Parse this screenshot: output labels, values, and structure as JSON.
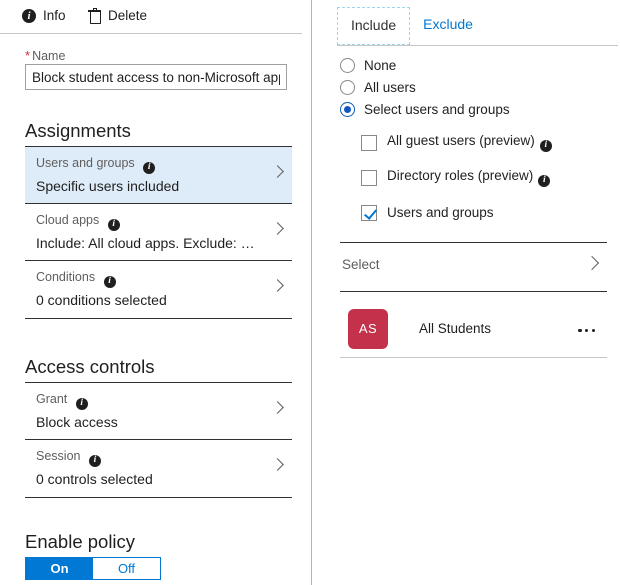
{
  "toolbar": {
    "info_label": "Info",
    "info_icon": "info-circle-icon",
    "delete_label": "Delete",
    "delete_icon": "trash-icon"
  },
  "name_field": {
    "required_marker": "*",
    "label": "Name",
    "value": "Block student access to non-Microsoft apps",
    "placeholder": "Name"
  },
  "assignments": {
    "title": "Assignments",
    "rows": [
      {
        "title": "Users and groups",
        "value": "Specific users included",
        "info_icon": "info-circle-icon",
        "chevron_icon": "chevron-right-icon",
        "selected": true
      },
      {
        "title": "Cloud apps",
        "value": "Include: All cloud apps. Exclude: …",
        "info_icon": "info-circle-icon",
        "chevron_icon": "chevron-right-icon",
        "selected": false
      },
      {
        "title": "Conditions",
        "value": "0 conditions selected",
        "info_icon": "info-circle-icon",
        "chevron_icon": "chevron-right-icon",
        "selected": false
      }
    ]
  },
  "access_controls": {
    "title": "Access controls",
    "rows": [
      {
        "title": "Grant",
        "value": "Block access",
        "info_icon": "info-circle-icon",
        "chevron_icon": "chevron-right-icon"
      },
      {
        "title": "Session",
        "value": "0 controls selected",
        "info_icon": "info-circle-icon",
        "chevron_icon": "chevron-right-icon"
      }
    ]
  },
  "enable_policy": {
    "title": "Enable policy",
    "on_label": "On",
    "off_label": "Off",
    "selected": "On"
  },
  "right_panel": {
    "tabs": [
      {
        "label": "Include",
        "active": true
      },
      {
        "label": "Exclude",
        "active": false
      }
    ],
    "radios": [
      {
        "label": "None",
        "checked": false
      },
      {
        "label": "All users",
        "checked": false
      },
      {
        "label": "Select users and groups",
        "checked": true
      }
    ],
    "checkboxes": [
      {
        "label": "All guest users (preview)",
        "checked": false,
        "has_info": true,
        "info_icon": "info-circle-icon"
      },
      {
        "label": "Directory roles (preview)",
        "checked": false,
        "has_info": true,
        "info_icon": "info-circle-icon"
      },
      {
        "label": "Users and groups",
        "checked": true,
        "has_info": false,
        "info_icon": ""
      }
    ],
    "select_row": {
      "label": "Select",
      "chevron_icon": "chevron-right-icon"
    },
    "members": [
      {
        "initials": "AS",
        "name": "All Students",
        "more_icon": "ellipsis-icon"
      }
    ]
  },
  "colors": {
    "accent_blue": "#0078d4",
    "selected_row_bg": "#deecf9",
    "avatar_bg": "#c4314b",
    "required_red": "#c4314b",
    "text_primary": "#201f1e",
    "text_secondary": "#605e5c"
  }
}
